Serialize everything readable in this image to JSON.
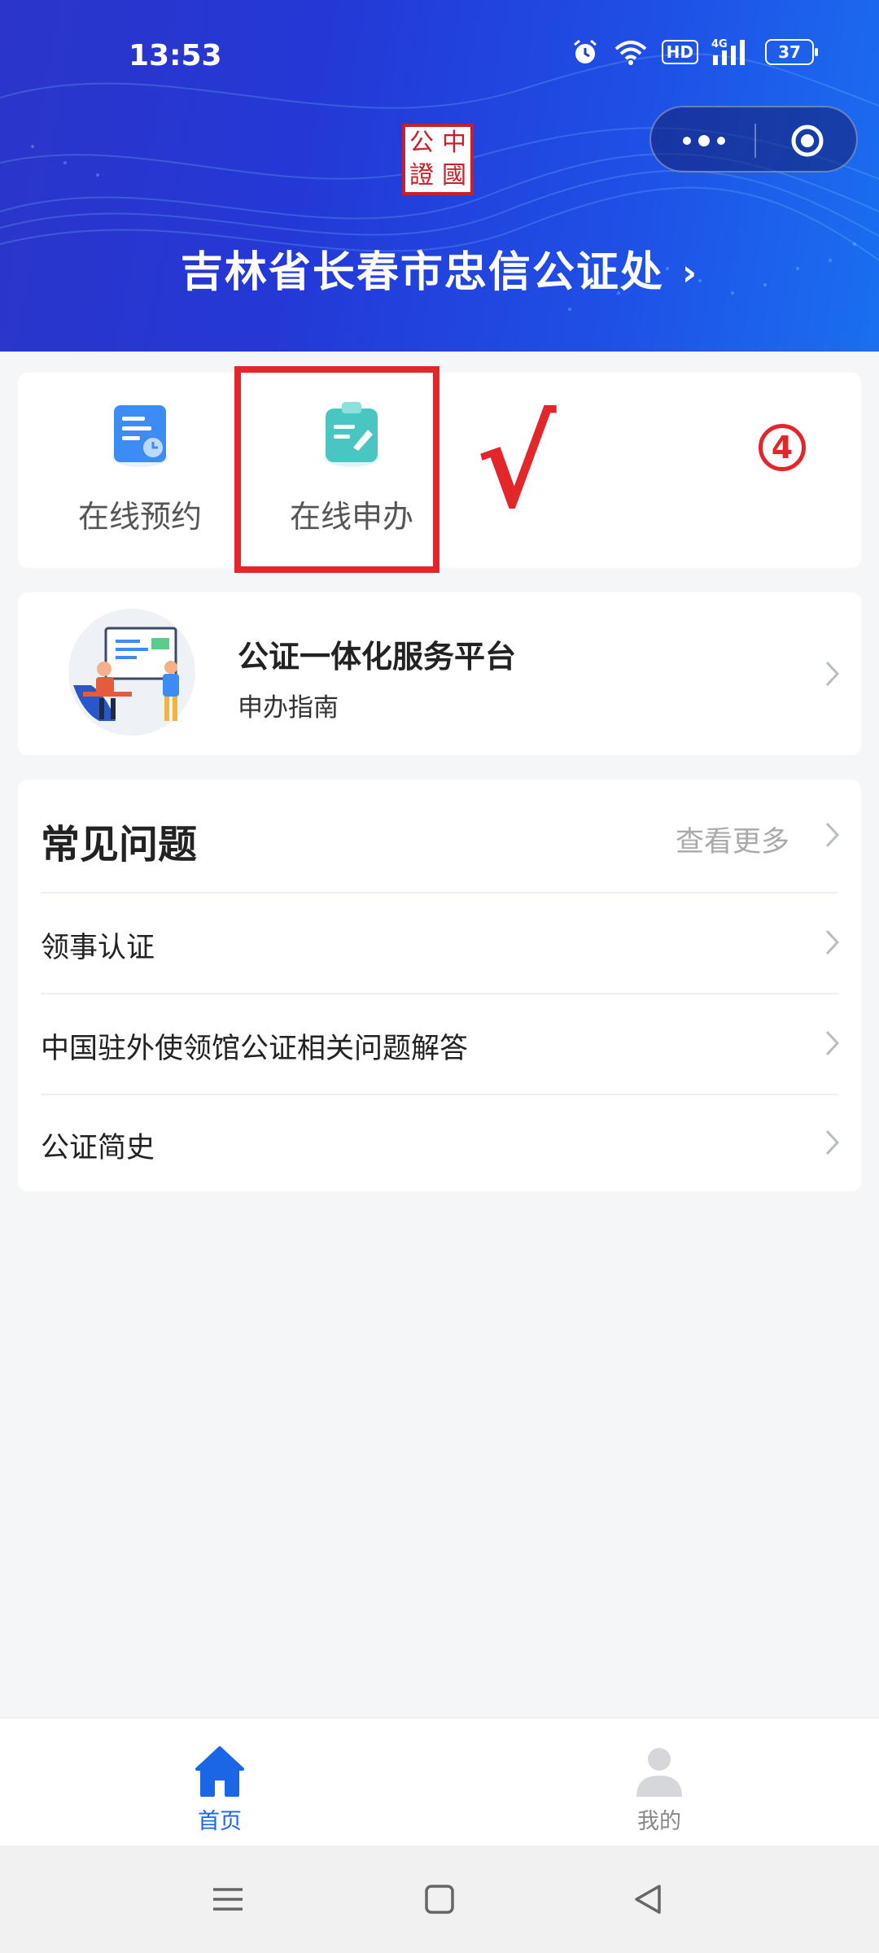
{
  "status_bar": {
    "time": "13:53",
    "hd": "HD",
    "network": "4G",
    "battery": "37",
    "icons": [
      "alarm-icon",
      "wifi-icon",
      "hd-icon",
      "signal-4g-icon",
      "battery-icon"
    ]
  },
  "header": {
    "title": "吉林省长春市忠信公证处",
    "seal_chars": [
      "中",
      "公",
      "國",
      "證"
    ],
    "capsule_icons": [
      "more-icon",
      "target-icon"
    ],
    "colors": {
      "gradient_start": "#2b35c9",
      "gradient_end": "#1a6ff0"
    }
  },
  "services": [
    {
      "label": "在线预约",
      "icon": "appointment-icon"
    },
    {
      "label": "在线申办",
      "icon": "apply-icon"
    }
  ],
  "annotations": {
    "check": "√",
    "step_number": "4",
    "color": "#e3262a"
  },
  "platform_card": {
    "title": "公证一体化服务平台",
    "subtitle": "申办指南"
  },
  "faq": {
    "title": "常见问题",
    "more_label": "查看更多",
    "items": [
      "领事认证",
      "中国驻外使领馆公证相关问题解答",
      "公证简史"
    ]
  },
  "tabbar": {
    "tabs": [
      {
        "label": "首页",
        "icon": "home-icon",
        "active": true
      },
      {
        "label": "我的",
        "icon": "user-icon",
        "active": false
      }
    ],
    "active_color": "#1a66e6"
  },
  "system_nav": [
    "menu-icon",
    "home-square-icon",
    "back-triangle-icon"
  ]
}
